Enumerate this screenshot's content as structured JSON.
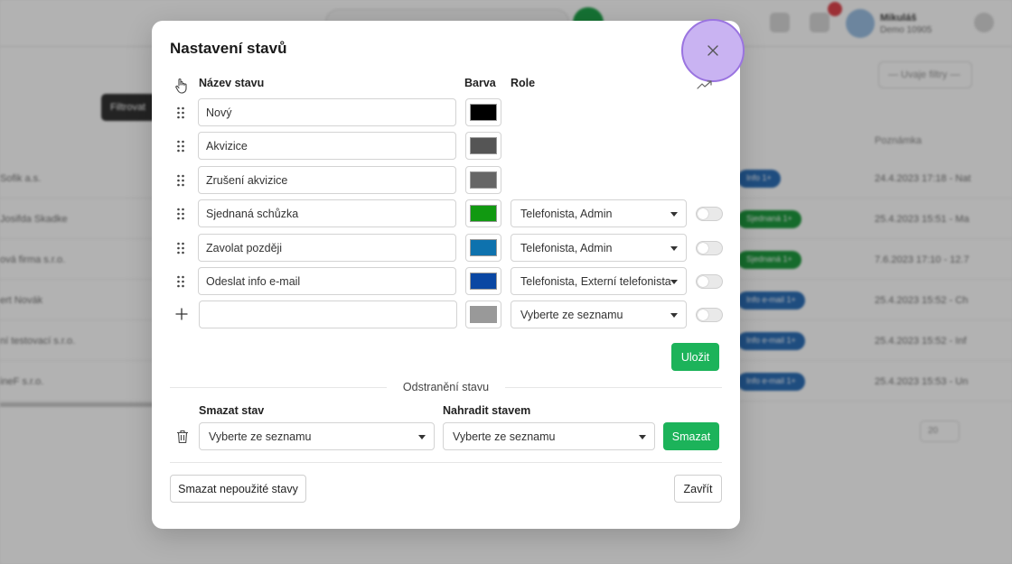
{
  "background": {
    "user_name": "Mikuláš",
    "user_sub": "Demo 10905",
    "filter_placeholder": "— Uvaje filtry —",
    "dark_button": "Filtrovat",
    "page_size": "20",
    "column_note": "Poznámka",
    "rows": [
      {
        "name": "Sofik a.s.",
        "note": "24.4.2023 17:18 - Nat",
        "pill": "Info 1+",
        "pill_color": "#2d6fb7"
      },
      {
        "name": "Josifda Skadke",
        "note": "25.4.2023 15:51 - Ma",
        "pill": "Sjednaná 1+",
        "pill_color": "#1f9a3f"
      },
      {
        "name": "ová firma s.r.o.",
        "note": "7.6.2023 17:10 - 12.7",
        "pill": "Sjednaná 1+",
        "pill_color": "#1f9a3f"
      },
      {
        "name": "ert Novák",
        "note": "25.4.2023 15:52 - Ch",
        "pill": "Info e-mail 1+",
        "pill_color": "#2d6fb7"
      },
      {
        "name": "ní testovací s.r.o.",
        "note": "25.4.2023 15:52 - Inf",
        "pill": "Info e-mail 1+",
        "pill_color": "#2d6fb7"
      },
      {
        "name": "ineF s.r.o.",
        "note": "25.4.2023 15:53 - Un",
        "pill": "Info e-mail 1+",
        "pill_color": "#2d6fb7"
      }
    ]
  },
  "modal": {
    "title": "Nastavení stavů",
    "headers": {
      "name": "Název stavu",
      "color": "Barva",
      "role": "Role"
    },
    "statuses": [
      {
        "name": "Nový",
        "color": "#000000",
        "roles": null
      },
      {
        "name": "Akvizice",
        "color": "#555555",
        "roles": null
      },
      {
        "name": "Zrušení akvizice",
        "color": "#666666",
        "roles": null
      },
      {
        "name": "Sjednaná schůzka",
        "color": "#119911",
        "roles": "Telefonista, Admin"
      },
      {
        "name": "Zavolat později",
        "color": "#0E72AE",
        "roles": "Telefonista, Admin"
      },
      {
        "name": "Odeslat info e-mail",
        "color": "#0A47A3",
        "roles": "Telefonista, Externí telefonista"
      }
    ],
    "new_status": {
      "name": "",
      "color": "#999999",
      "roles_placeholder": "Vyberte ze seznamu"
    },
    "save_label": "Uložit",
    "removal_section": "Odstranění stavu",
    "delete_label": "Smazat stav",
    "replace_label": "Nahradit stavem",
    "delete_select": "Vyberte ze seznamu",
    "replace_select": "Vyberte ze seznamu",
    "delete_button": "Smazat",
    "delete_unused_button": "Smazat nepoužité stavy",
    "close_button": "Zavřít"
  }
}
